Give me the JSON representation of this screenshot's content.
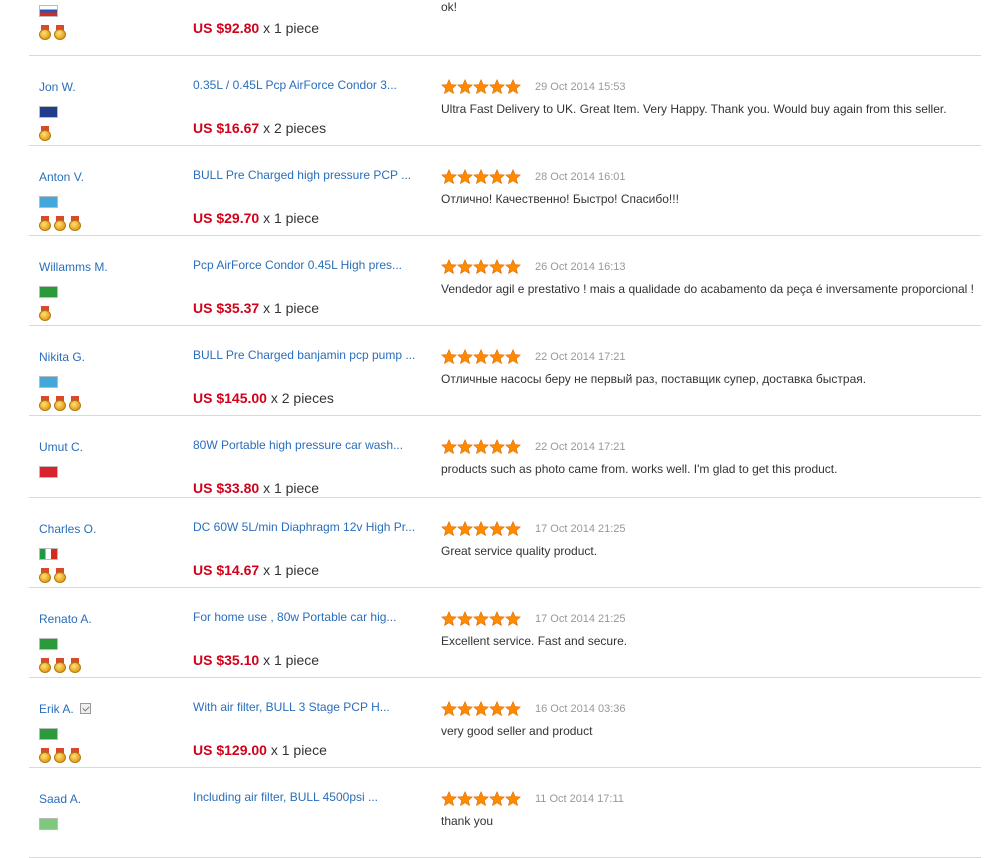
{
  "colors": {
    "link": "#2a6ebb",
    "price": "#d0021b",
    "star": "#ff8a00",
    "date": "#999999"
  },
  "rows": [
    {
      "name": "",
      "flag": "ru",
      "medals": 2,
      "product": "",
      "price": "US $92.80",
      "qty": "x 1 piece",
      "date": "",
      "comment": "ok!"
    },
    {
      "name": "Jon W.",
      "flag": "gb",
      "medals": 1,
      "product": "0.35L / 0.45L Pcp AirForce Condor 3...",
      "price": "US $16.67",
      "qty": "x 2 pieces",
      "date": "29 Oct 2014 15:53",
      "comment": "Ultra Fast Delivery to UK. Great Item. Very Happy. Thank you. Would buy again from this seller."
    },
    {
      "name": "Anton V.",
      "flag": "kz",
      "medals": 3,
      "product": "BULL Pre Charged high pressure PCP ...",
      "price": "US $29.70",
      "qty": "x 1 piece",
      "date": "28 Oct 2014 16:01",
      "comment": "Отлично! Качественно! Быстро! Спасибо!!!"
    },
    {
      "name": "Willamms M.",
      "flag": "br",
      "medals": 1,
      "product": "Pcp AirForce Condor 0.45L High pres...",
      "price": "US $35.37",
      "qty": "x 1 piece",
      "date": "26 Oct 2014 16:13",
      "comment": "Vendedor agil e prestativo ! mais a qualidade do acabamento da peça é inversamente proporcional !"
    },
    {
      "name": "Nikita G.",
      "flag": "kz",
      "medals": 3,
      "product": "BULL Pre Charged banjamin pcp pump ...",
      "price": "US $145.00",
      "qty": "x 2 pieces",
      "date": "22 Oct 2014 17:21",
      "comment": "Отличные насосы беру не первый раз, поставщик супер, доставка быстрая."
    },
    {
      "name": "Umut C.",
      "flag": "tr",
      "medals": 0,
      "product": "80W Portable high pressure car wash...",
      "price": "US $33.80",
      "qty": "x 1 piece",
      "date": "22 Oct 2014 17:21",
      "comment": "products such as photo came from. works well. I'm glad to get this product."
    },
    {
      "name": "Charles O.",
      "flag": "it",
      "medals": 2,
      "product": "DC 60W 5L/min Diaphragm 12v High Pr...",
      "price": "US $14.67",
      "qty": "x 1 piece",
      "date": "17 Oct 2014 21:25",
      "comment": "Great service quality product."
    },
    {
      "name": "Renato A.",
      "flag": "br",
      "medals": 3,
      "product": "For home use , 80w Portable car hig...",
      "price": "US $35.10",
      "qty": "x 1 piece",
      "date": "17 Oct 2014 21:25",
      "comment": "Excellent service. Fast and secure."
    },
    {
      "name": "Erik A.",
      "flag": "br",
      "medals": 3,
      "verified": true,
      "product": "With air filter, BULL 3 Stage PCP H...",
      "price": "US $129.00",
      "qty": "x 1 piece",
      "date": "16 Oct 2014 03:36",
      "comment": "very good seller and product"
    },
    {
      "name": "Saad A.",
      "flag": "sa",
      "medals": 0,
      "product": "Including air filter, BULL 4500psi ...",
      "price": "",
      "qty": "",
      "date": "11 Oct 2014 17:11",
      "comment": "thank you"
    }
  ]
}
